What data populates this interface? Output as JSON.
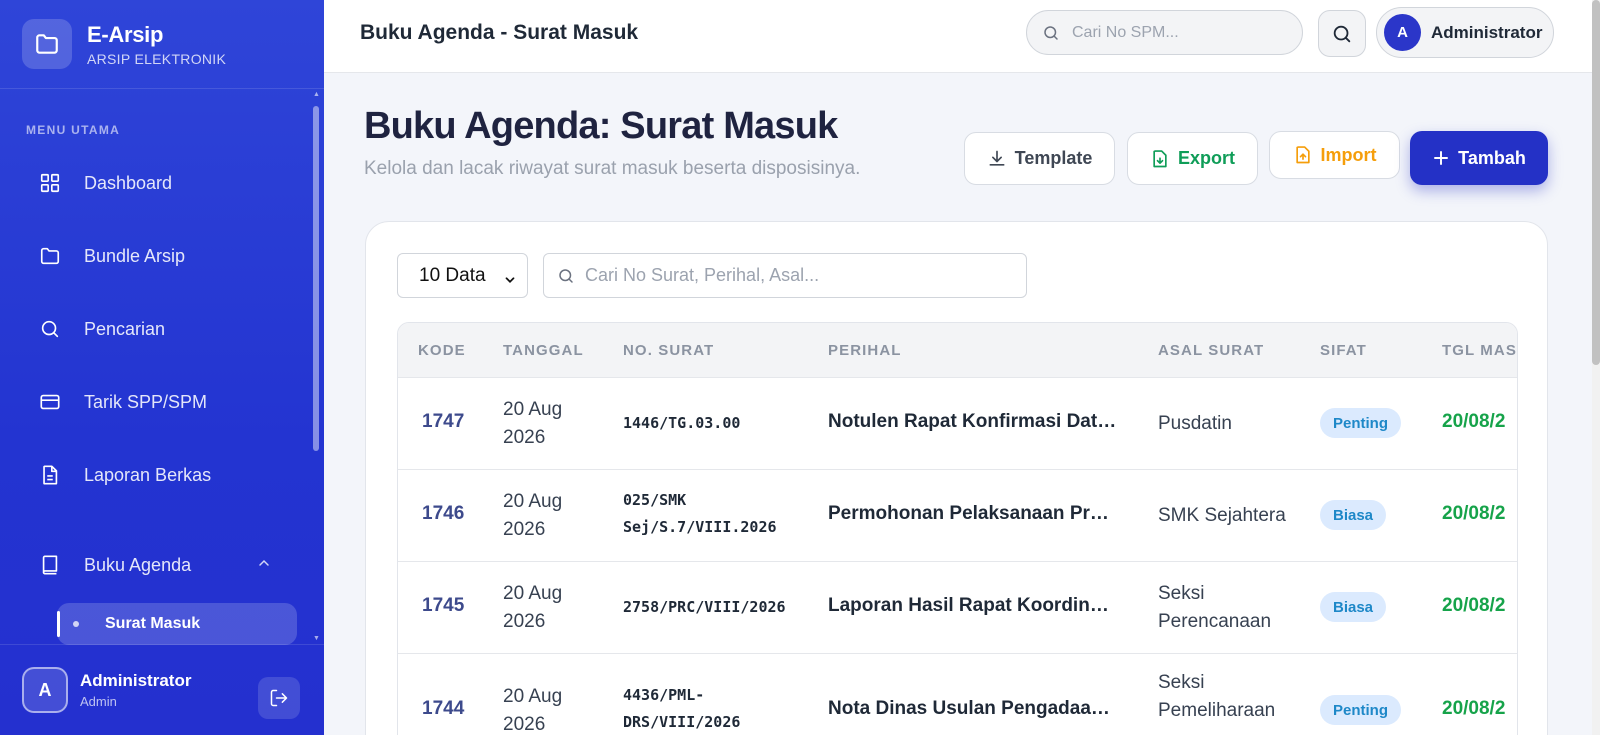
{
  "brand": {
    "title": "E-Arsip",
    "subtitle": "ARSIP ELEKTRONIK"
  },
  "sidebar": {
    "menu_heading": "MENU UTAMA",
    "items": [
      {
        "label": "Dashboard",
        "icon": "grid-icon"
      },
      {
        "label": "Bundle Arsip",
        "icon": "folder-icon"
      },
      {
        "label": "Pencarian",
        "icon": "search-icon"
      },
      {
        "label": "Tarik SPP/SPM",
        "icon": "card-icon"
      },
      {
        "label": "Laporan Berkas",
        "icon": "document-icon"
      },
      {
        "label": "Buku Agenda",
        "icon": "book-icon"
      }
    ],
    "subitem": "Surat Masuk",
    "user": {
      "initial": "A",
      "name": "Administrator",
      "role": "Admin"
    }
  },
  "topbar": {
    "title": "Buku Agenda - Surat Masuk",
    "search_placeholder": "Cari No SPM...",
    "user_initial": "A",
    "user_name": "Administrator"
  },
  "header": {
    "title": "Buku Agenda: Surat Masuk",
    "subtitle": "Kelola dan lacak riwayat surat masuk beserta disposisinya.",
    "buttons": {
      "template": "Template",
      "export": "Export",
      "import": "Import",
      "add": "Tambah"
    }
  },
  "table": {
    "page_size": "10 Data",
    "search_placeholder": "Cari No Surat, Perihal, Asal...",
    "columns": [
      "KODE",
      "TANGGAL",
      "NO. SURAT",
      "PERIHAL",
      "ASAL SURAT",
      "SIFAT",
      "TGL MAS"
    ],
    "rows": [
      {
        "kode": "1747",
        "tanggal": "20 Aug 2026",
        "no_surat": "1446/TG.03.00",
        "perihal": "Notulen Rapat Konfirmasi Data (…",
        "asal": "Pusdatin",
        "sifat": "Penting",
        "tgl_masuk": "20/08/2"
      },
      {
        "kode": "1746",
        "tanggal": "20 Aug 2026",
        "no_surat": "025/SMK Sej/S.7/VIII.2026",
        "perihal": "Permohonan Pelaksanaan Prak…",
        "asal": "SMK Sejahtera",
        "sifat": "Biasa",
        "tgl_masuk": "20/08/2"
      },
      {
        "kode": "1745",
        "tanggal": "20 Aug 2026",
        "no_surat": "2758/PRC/VIII/2026",
        "perihal": "Laporan Hasil Rapat Koordinasi …",
        "asal": "Seksi Perencanaan",
        "sifat": "Biasa",
        "tgl_masuk": "20/08/2"
      },
      {
        "kode": "1744",
        "tanggal": "20 Aug 2026",
        "no_surat": "4436/PML-DRS/VIII/2026",
        "perihal": "Nota Dinas Usulan Pengadaan …",
        "asal": "Seksi Pemeliharaan",
        "sifat": "Penting",
        "tgl_masuk": "20/08/2"
      }
    ]
  },
  "colors": {
    "sidebar": "#2334d1",
    "accent": "#2431c6",
    "export": "#0f9d58",
    "import": "#f59e0b",
    "date_green": "#16a34a",
    "badge_bg": "#dbeafe",
    "badge_text": "#1e88c8"
  }
}
